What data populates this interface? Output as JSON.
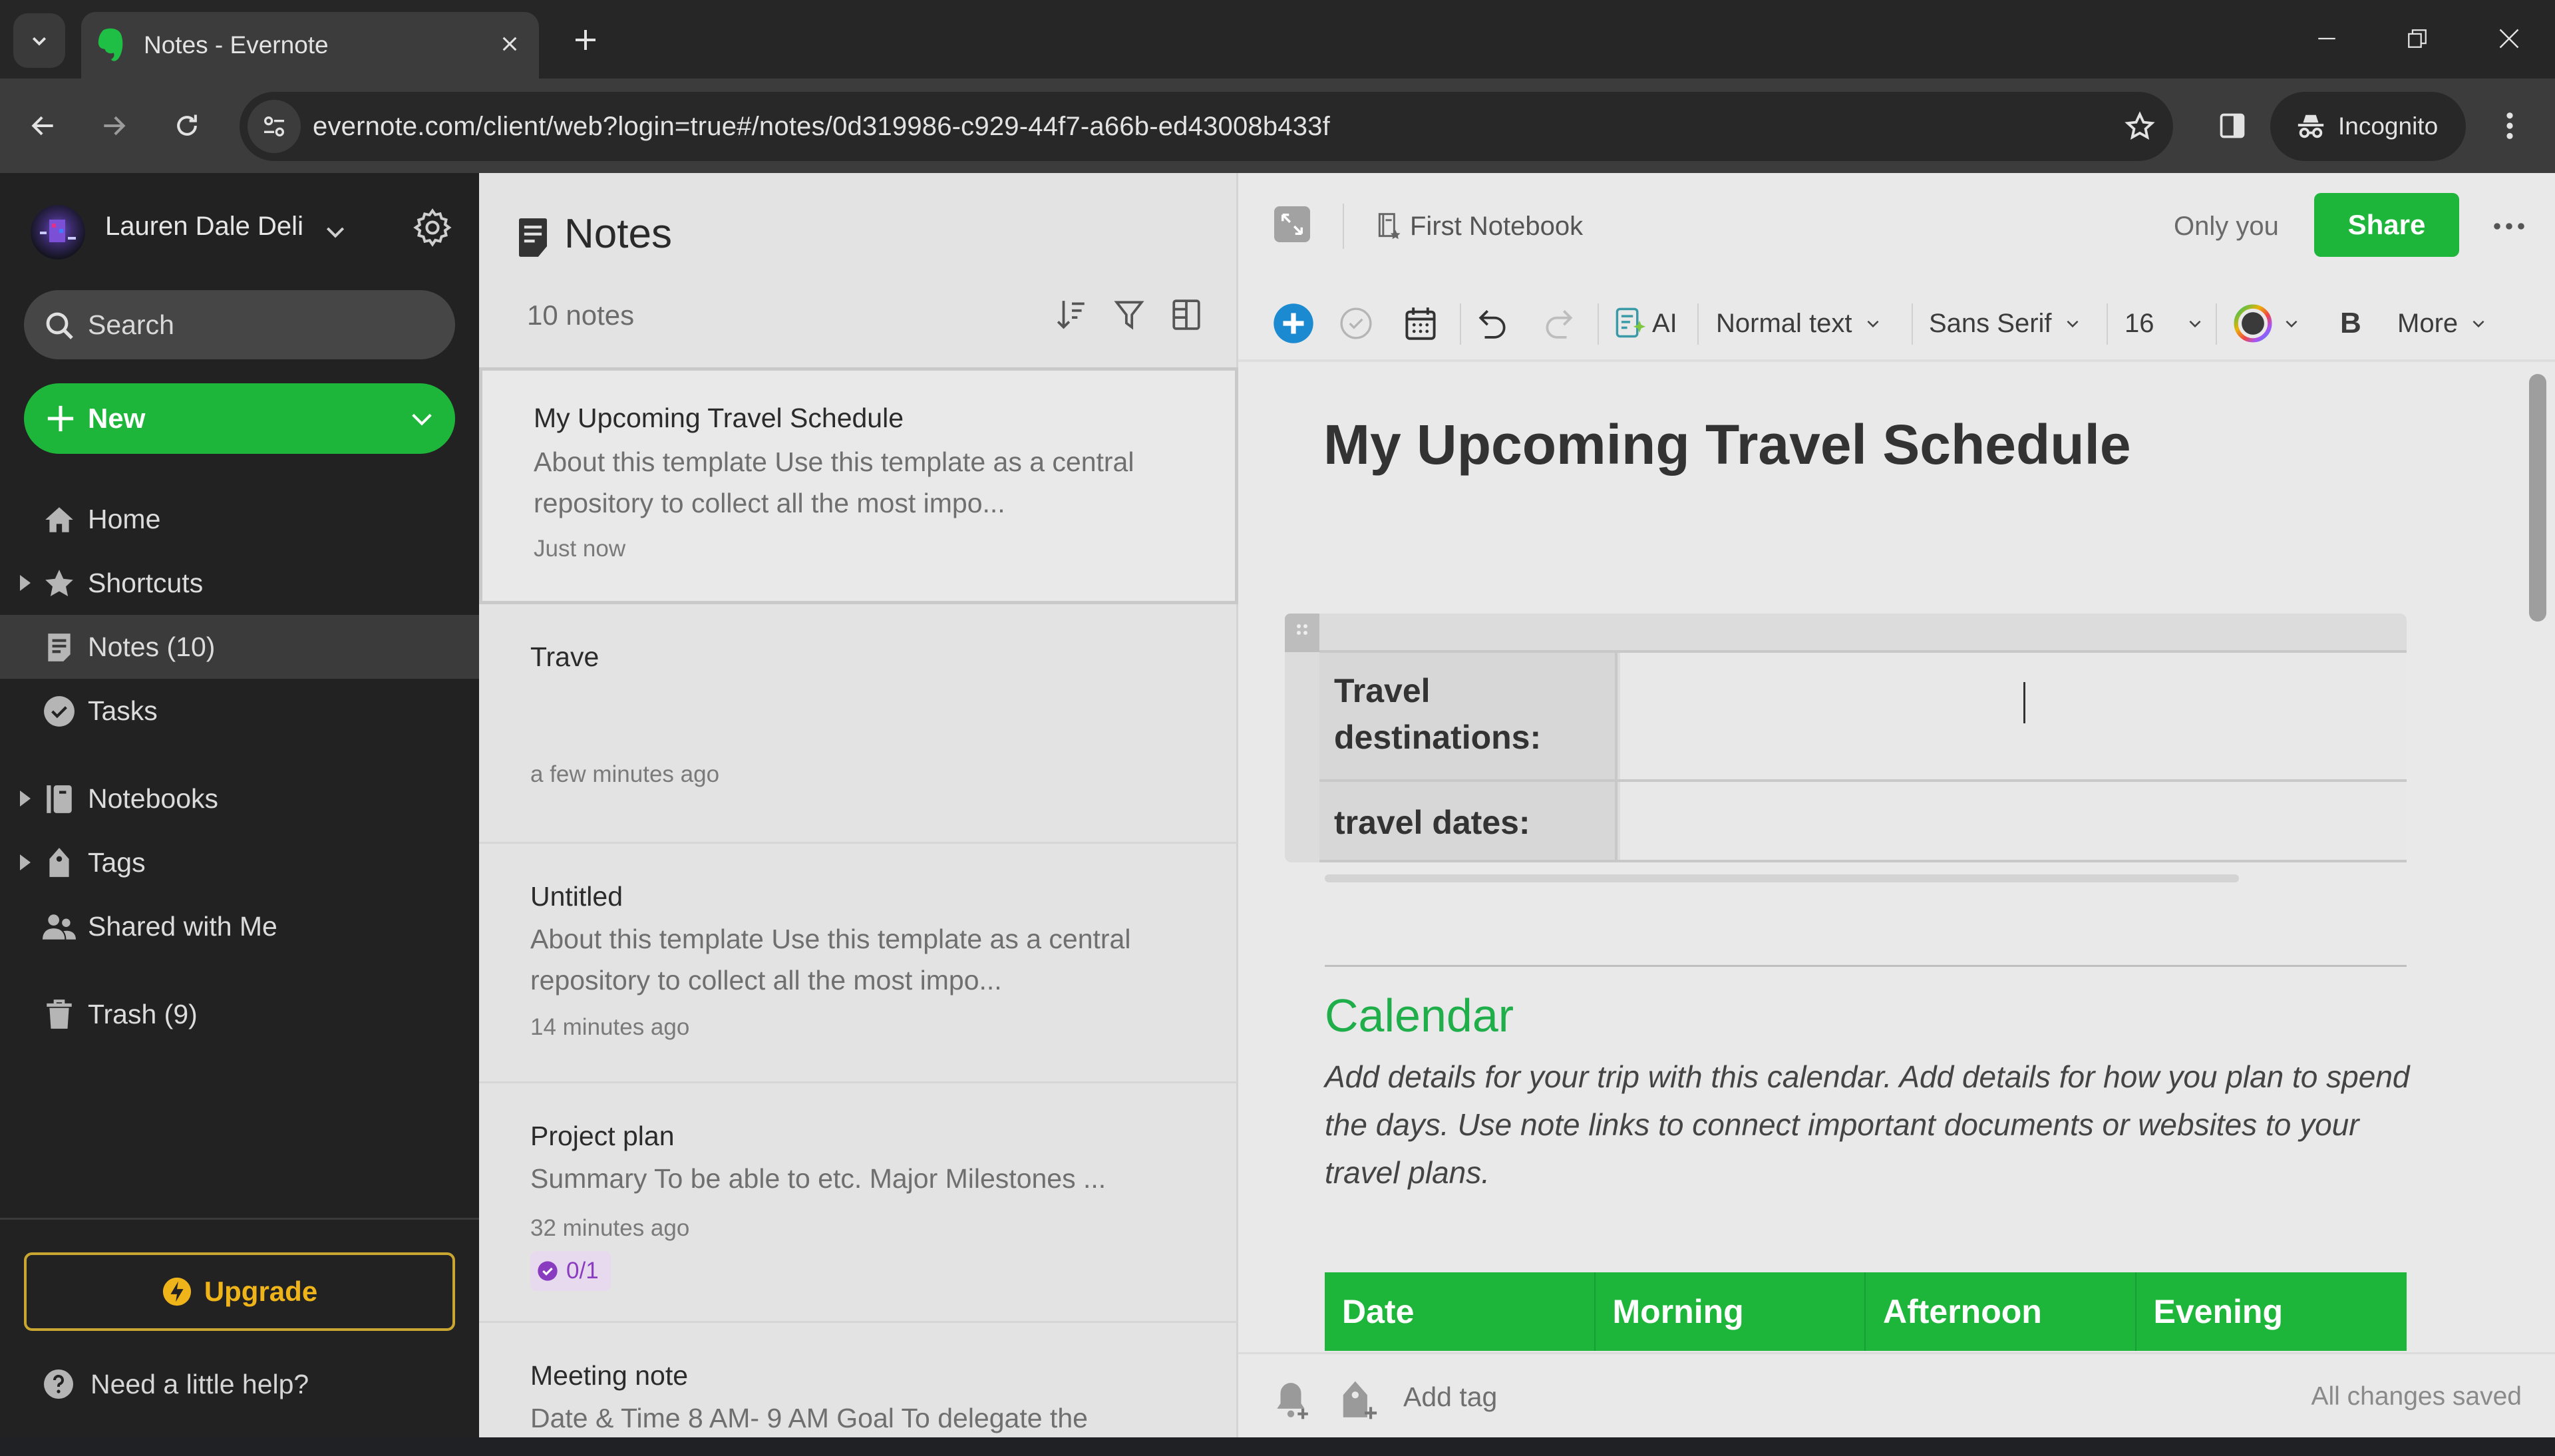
{
  "browser": {
    "tab_title": "Notes - Evernote",
    "url": "evernote.com/client/web?login=true#/notes/0d319986-c929-44f7-a66b-ed43008b433f",
    "incognito_label": "Incognito",
    "icons": {
      "tab_search": "chevron-down-icon",
      "favicon": "evernote-elephant-icon",
      "tab_close": "close-icon",
      "new_tab": "plus-icon",
      "back": "arrow-left-icon",
      "forward": "arrow-right-icon",
      "reload": "reload-icon",
      "site_info": "tune-icon",
      "bookmark": "star-outline-icon",
      "side_panel": "side-panel-icon",
      "incognito": "incognito-icon",
      "menu": "kebab-icon",
      "minimize": "minimize-icon",
      "restore": "restore-icon",
      "close_window": "close-icon"
    }
  },
  "sidebar": {
    "account_name": "Lauren Dale Deli",
    "search_placeholder": "Search",
    "new_label": "New",
    "items": [
      {
        "label": "Home",
        "icon": "home-icon",
        "expandable": false,
        "active": false
      },
      {
        "label": "Shortcuts",
        "icon": "star-icon",
        "expandable": true,
        "active": false
      },
      {
        "label": "Notes (10)",
        "icon": "note-icon",
        "expandable": false,
        "active": true
      },
      {
        "label": "Tasks",
        "icon": "check-circle-icon",
        "expandable": false,
        "active": false
      },
      {
        "label": "Notebooks",
        "icon": "notebook-icon",
        "expandable": true,
        "active": false
      },
      {
        "label": "Tags",
        "icon": "tag-icon",
        "expandable": true,
        "active": false
      },
      {
        "label": "Shared with Me",
        "icon": "people-icon",
        "expandable": false,
        "active": false
      },
      {
        "label": "Trash (9)",
        "icon": "trash-icon",
        "expandable": false,
        "active": false
      }
    ],
    "upgrade_label": "Upgrade",
    "help_label": "Need a little help?",
    "colors": {
      "accent_green": "#1db63b",
      "upgrade_gold": "#f0b41b"
    }
  },
  "notelist": {
    "title": "Notes",
    "count_label": "10 notes",
    "notes": [
      {
        "title": "My Upcoming Travel Schedule",
        "snippet": "About this template Use this template as a central repository to collect all the most impo...",
        "date": "Just now",
        "selected": true
      },
      {
        "title": "Trave",
        "snippet": "",
        "date": "a few minutes ago",
        "selected": false
      },
      {
        "title": "Untitled",
        "snippet": "About this template Use this template as a central repository to collect all the most impo...",
        "date": "14 minutes ago",
        "selected": false
      },
      {
        "title": "Project plan",
        "snippet": "Summary To be able to etc. Major Milestones ...",
        "date": "32 minutes ago",
        "tasks": "0/1",
        "selected": false
      },
      {
        "title": "Meeting note",
        "snippet": "Date & Time 8 AM- 9 AM Goal To delegate the",
        "date": "",
        "selected": false
      }
    ]
  },
  "editor": {
    "notebook": "First Notebook",
    "visibility": "Only you",
    "share_label": "Share",
    "toolbar": {
      "ai_label": "AI",
      "text_style": "Normal text",
      "font": "Sans Serif",
      "font_size": "16",
      "bold_label": "B",
      "more_label": "More"
    },
    "note_title": "My Upcoming Travel Schedule",
    "info_table": [
      {
        "key": "Travel destinations:",
        "value": ""
      },
      {
        "key": "travel dates:",
        "value": ""
      }
    ],
    "calendar_heading": "Calendar",
    "calendar_description": "Add details for your trip with this calendar. Add details for how you plan to spend the days. Use note links to connect important documents or websites to your travel plans.",
    "calendar_columns": [
      "Date",
      "Morning",
      "Afternoon",
      "Evening"
    ],
    "footer": {
      "add_tag": "Add tag",
      "status": "All changes saved"
    },
    "colors": {
      "heading_green": "#1fae4a",
      "table_header_green": "#1db63b",
      "insert_blue": "#1c8ad0"
    }
  }
}
